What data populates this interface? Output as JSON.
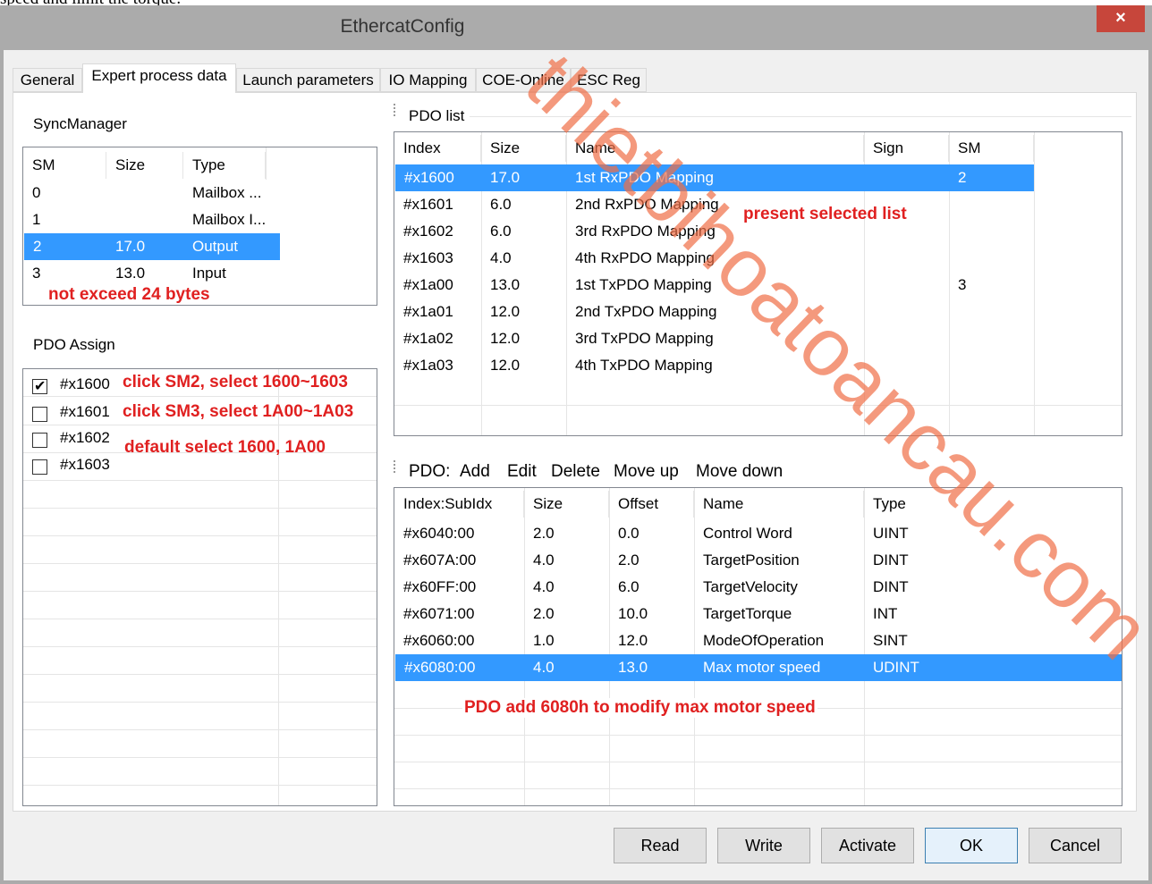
{
  "page_top_text": "speed and limit the torque.",
  "window": {
    "title": "EthercatConfig",
    "close_label": "×"
  },
  "tabs": [
    {
      "label": "General"
    },
    {
      "label": "Expert process data",
      "active": true
    },
    {
      "label": "Launch parameters"
    },
    {
      "label": "IO Mapping"
    },
    {
      "label": "COE-Online"
    },
    {
      "label": "ESC Reg"
    }
  ],
  "sync_manager": {
    "title": "SyncManager",
    "columns": [
      "SM",
      "Size",
      "Type"
    ],
    "rows": [
      {
        "sm": "0",
        "size": "",
        "type": "Mailbox ..."
      },
      {
        "sm": "1",
        "size": "",
        "type": "Mailbox I..."
      },
      {
        "sm": "2",
        "size": "17.0",
        "type": "Output",
        "selected": true
      },
      {
        "sm": "3",
        "size": "13.0",
        "type": "Input"
      }
    ]
  },
  "pdo_assign": {
    "title": "PDO Assign",
    "items": [
      {
        "label": "#x1600",
        "checked": true
      },
      {
        "label": "#x1601",
        "checked": false
      },
      {
        "label": "#x1602",
        "checked": false
      },
      {
        "label": "#x1603",
        "checked": false
      }
    ]
  },
  "pdo_list": {
    "title": "PDO list",
    "columns": [
      "Index",
      "Size",
      "Name",
      "Sign",
      "SM"
    ],
    "rows": [
      {
        "index": "#x1600",
        "size": "17.0",
        "name": "1st RxPDO Mapping",
        "sign": "",
        "sm": "2",
        "selected": true
      },
      {
        "index": "#x1601",
        "size": "6.0",
        "name": "2nd RxPDO Mapping",
        "sign": "",
        "sm": ""
      },
      {
        "index": "#x1602",
        "size": "6.0",
        "name": "3rd RxPDO Mapping",
        "sign": "",
        "sm": ""
      },
      {
        "index": "#x1603",
        "size": "4.0",
        "name": "4th RxPDO Mapping",
        "sign": "",
        "sm": ""
      },
      {
        "index": "#x1a00",
        "size": "13.0",
        "name": "1st TxPDO Mapping",
        "sign": "",
        "sm": "3"
      },
      {
        "index": "#x1a01",
        "size": "12.0",
        "name": "2nd TxPDO Mapping",
        "sign": "",
        "sm": ""
      },
      {
        "index": "#x1a02",
        "size": "12.0",
        "name": "3rd TxPDO Mapping",
        "sign": "",
        "sm": ""
      },
      {
        "index": "#x1a03",
        "size": "12.0",
        "name": "4th TxPDO Mapping",
        "sign": "",
        "sm": ""
      }
    ]
  },
  "pdo_toolbar": {
    "label": "PDO:",
    "add": "Add",
    "edit": "Edit",
    "delete": "Delete",
    "move_up": "Move up",
    "move_down": "Move down"
  },
  "pdo_entries": {
    "columns": [
      "Index:SubIdx",
      "Size",
      "Offset",
      "Name",
      "Type"
    ],
    "rows": [
      {
        "index": "#x6040:00",
        "size": "2.0",
        "offset": "0.0",
        "name": "Control Word",
        "type": "UINT"
      },
      {
        "index": "#x607A:00",
        "size": "4.0",
        "offset": "2.0",
        "name": "TargetPosition",
        "type": "DINT"
      },
      {
        "index": "#x60FF:00",
        "size": "4.0",
        "offset": "6.0",
        "name": "TargetVelocity",
        "type": "DINT"
      },
      {
        "index": "#x6071:00",
        "size": "2.0",
        "offset": "10.0",
        "name": "TargetTorque",
        "type": "INT"
      },
      {
        "index": "#x6060:00",
        "size": "1.0",
        "offset": "12.0",
        "name": "ModeOfOperation",
        "type": "SINT"
      },
      {
        "index": "#x6080:00",
        "size": "4.0",
        "offset": "13.0",
        "name": "Max motor speed",
        "type": "UDINT",
        "selected": true
      }
    ]
  },
  "annotations": {
    "sm_note": "not exceed 24 bytes",
    "click_sm2": "click SM2, select 1600~1603",
    "click_sm3": "click SM3, select 1A00~1A03",
    "default_select": "default select 1600, 1A00",
    "present_list": "present selected list",
    "pdo_add": "PDO add 6080h to modify max motor speed"
  },
  "buttons": {
    "read": "Read",
    "write": "Write",
    "activate": "Activate",
    "ok": "OK",
    "cancel": "Cancel"
  },
  "watermark": "thietbihoatoancau.com",
  "colors": {
    "selection": "#3399ff",
    "annotation": "#e02020",
    "close_button": "#c7463b",
    "title_bar": "#ababab"
  }
}
